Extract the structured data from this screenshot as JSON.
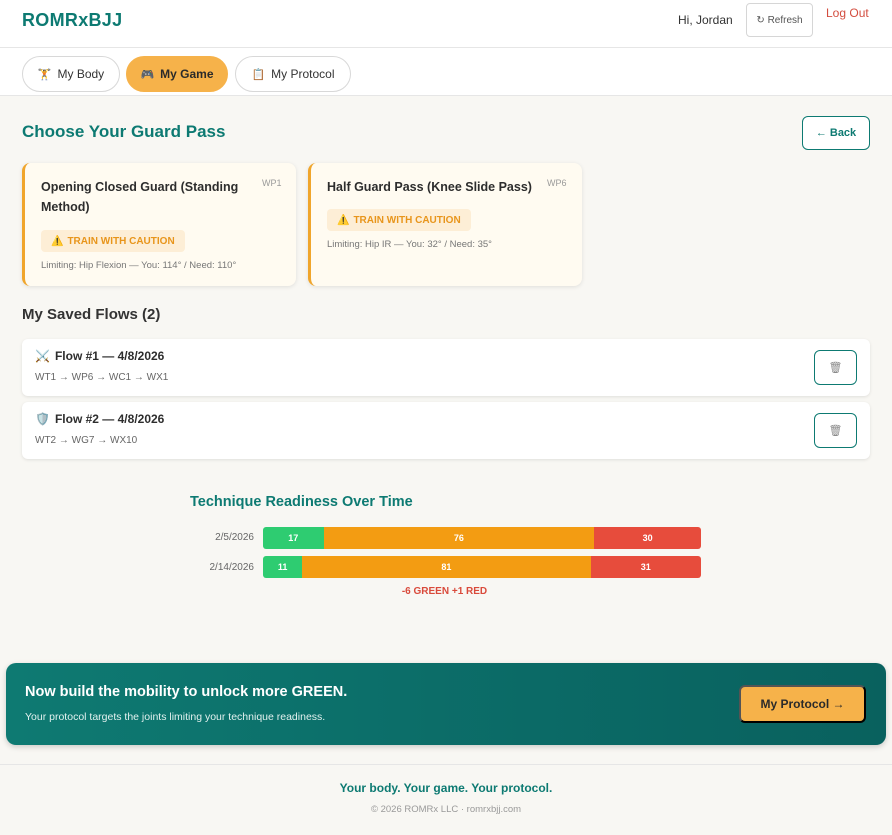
{
  "header": {
    "brand": "ROMRxBJJ",
    "greeting": "Hi, Jordan",
    "refresh_label": "↻ Refresh",
    "logout_label": "Log Out"
  },
  "tabs": [
    {
      "icon": "🏋",
      "icon_name": "weightlifter-icon",
      "label": "My Body",
      "active": false
    },
    {
      "icon": "🎮",
      "icon_name": "gamepad-icon",
      "label": "My Game",
      "active": true
    },
    {
      "icon": "📋",
      "icon_name": "clipboard-icon",
      "label": "My Protocol",
      "active": false
    }
  ],
  "main": {
    "title": "Choose Your Guard Pass",
    "back_label": "← Back"
  },
  "pass_cards": [
    {
      "title": "Opening Closed Guard (Standing Method)",
      "code": "WP1",
      "badge": "TRAIN WITH CAUTION",
      "limiting": "Limiting: Hip Flexion — You: 114° / Need: 110°"
    },
    {
      "title": "Half Guard Pass (Knee Slide Pass)",
      "code": "WP6",
      "badge": "TRAIN WITH CAUTION",
      "limiting": "Limiting: Hip IR — You: 32° / Need: 35°"
    }
  ],
  "flows": {
    "title": "My Saved Flows (2)",
    "items": [
      {
        "icon": "⚔️",
        "icon_name": "crossed-swords-icon",
        "name": "Flow #1 — 4/8/2026",
        "path": "WT1 → WP6 → WC1 → WX1"
      },
      {
        "icon": "🛡️",
        "icon_name": "shield-icon",
        "name": "Flow #2 — 4/8/2026",
        "path": "WT2 → WG7 → WX10"
      }
    ]
  },
  "readiness": {
    "title": "Technique Readiness Over Time",
    "delta": "-6 GREEN +1 RED",
    "colors": {
      "green": "#2ecc71",
      "orange": "#f39c12",
      "red": "#e74c3c"
    },
    "rows": [
      {
        "date": "2/5/2026",
        "green": 17,
        "orange": 76,
        "red": 30
      },
      {
        "date": "2/14/2026",
        "green": 11,
        "orange": 81,
        "red": 31
      }
    ]
  },
  "cta": {
    "title": "Now build the mobility to unlock more GREEN.",
    "subtitle": "Your protocol targets the joints limiting your technique readiness.",
    "button_label": "My Protocol →"
  },
  "footer": {
    "tagline": "Your body. Your game. Your protocol.",
    "copyright": "© 2026 ROMRx LLC · romrxbjj.com"
  }
}
